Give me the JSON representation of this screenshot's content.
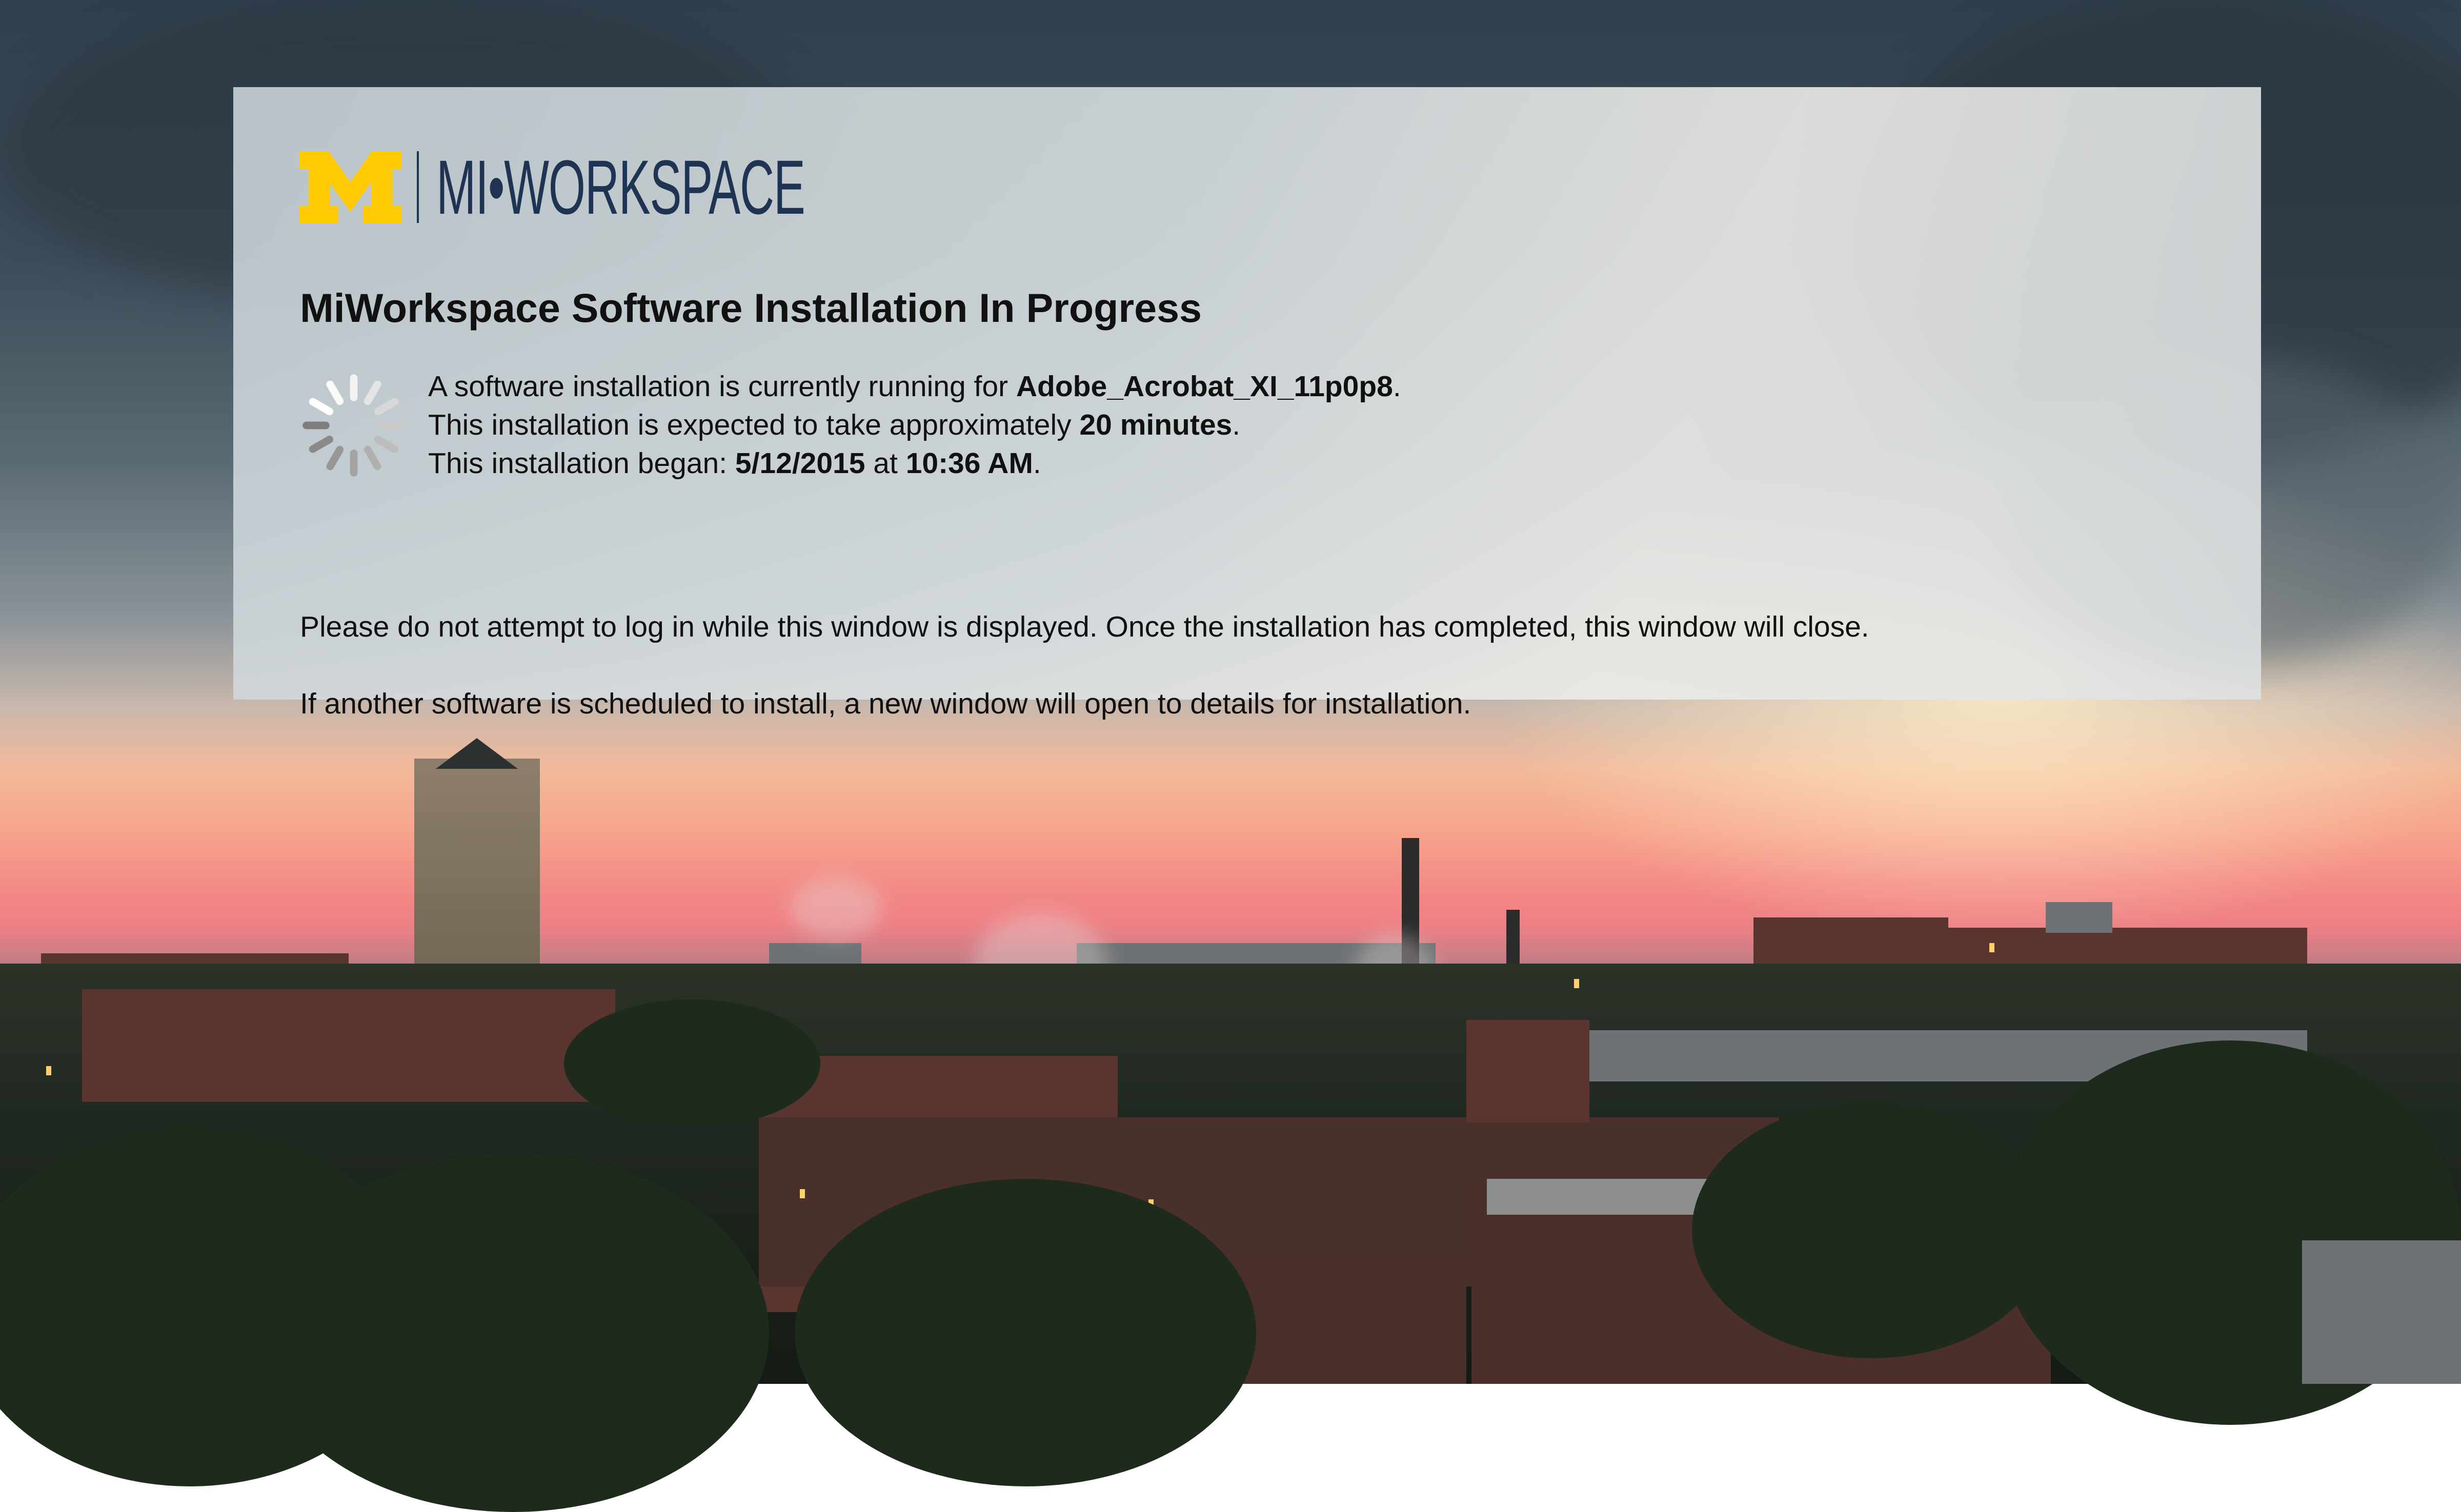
{
  "logo": {
    "mark": "M",
    "wordmark": "MI•WORKSPACE",
    "colors": {
      "maize": "#FFCB05",
      "blue": "#1F3353"
    }
  },
  "dialog": {
    "title": "MiWorkspace Software Installation In Progress",
    "spinner_icon": "loading-spinner-icon",
    "line1": {
      "prefix": "A software installation is currently running for ",
      "software": "Adobe_Acrobat_XI_11p0p8",
      "suffix": "."
    },
    "line2": {
      "prefix": "This installation is expected to take approximately ",
      "duration": "20 minutes",
      "suffix": "."
    },
    "line3": {
      "prefix": "This installation began: ",
      "date": "5/12/2015",
      "mid": " at ",
      "time": "10:36 AM",
      "suffix": "."
    },
    "notice": "Please do not attempt to log in while this window is displayed. Once the installation has completed, this window will close.",
    "next_notice": "If another software is scheduled to install, a new window will open to details for installation."
  }
}
